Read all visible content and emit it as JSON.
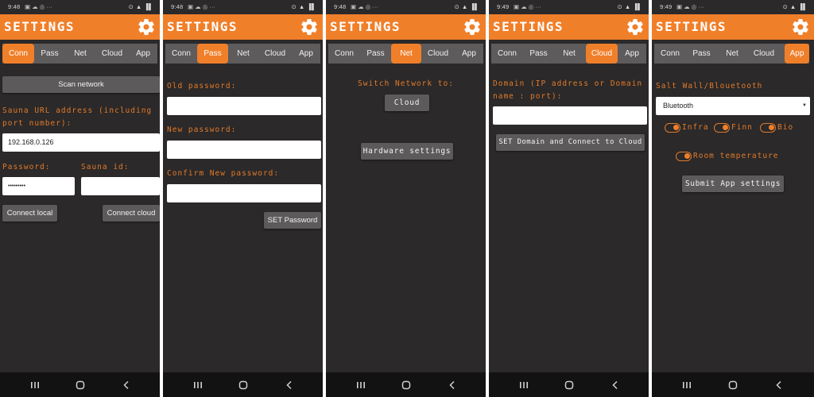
{
  "accent_color": "#f07f2a",
  "background_color": "#2b2929",
  "app": {
    "title": "SETTINGS"
  },
  "tabs": [
    "Conn",
    "Pass",
    "Net",
    "Cloud",
    "App"
  ],
  "status_bars": [
    {
      "time": "9:48",
      "extra": "▣ ☁ ◎ ···",
      "right": "⊙ ▲ ▐▌"
    },
    {
      "time": "9:48",
      "extra": "▣ ☁ ◎ ···",
      "right": "⊙ ▲ ▐▌"
    },
    {
      "time": "9:48",
      "extra": "▣ ☁ ◎ ···",
      "right": "⊙ ▲ ▐▌"
    },
    {
      "time": "9:49",
      "extra": "▣ ☁ ◎ ···",
      "right": "⊙ ▲ ▐▌"
    },
    {
      "time": "9:49",
      "extra": "▣ ☁ ◎ ···",
      "right": "⊙ ▲ ▐▌"
    }
  ],
  "conn": {
    "scan_label": "Scan network",
    "url_label": "Sauna URL address (including port number):",
    "url_value": "192.168.0.126",
    "password_label": "Password:",
    "password_value": "•••••••••",
    "sauna_id_label": "Sauna id:",
    "sauna_id_value": "",
    "connect_local_label": "Connect local",
    "connect_cloud_label": "Connect cloud"
  },
  "pass": {
    "old_label": "Old password:",
    "new_label": "New password:",
    "confirm_label": "Confirm New password:",
    "old_value": "",
    "new_value": "",
    "confirm_value": "",
    "set_label": "SET Password"
  },
  "net": {
    "switch_label": "Switch Network to:",
    "cloud_label": "Cloud",
    "hardware_label": "Hardware settings"
  },
  "cloud": {
    "domain_label": "Domain (IP address or Domain name : port):",
    "domain_value": "",
    "set_label": "SET Domain and Connect to Cloud"
  },
  "app_panel": {
    "salt_label": "Salt Wall/Blouetooth",
    "salt_selected": "Bluetooth",
    "infra_label": "Infra",
    "finn_label": "Finn",
    "bio_label": "Bio",
    "room_label": "Room temperature",
    "submit_label": "Submit App settings"
  },
  "nav_icons": [
    "recent-apps-icon",
    "home-icon",
    "back-icon"
  ]
}
